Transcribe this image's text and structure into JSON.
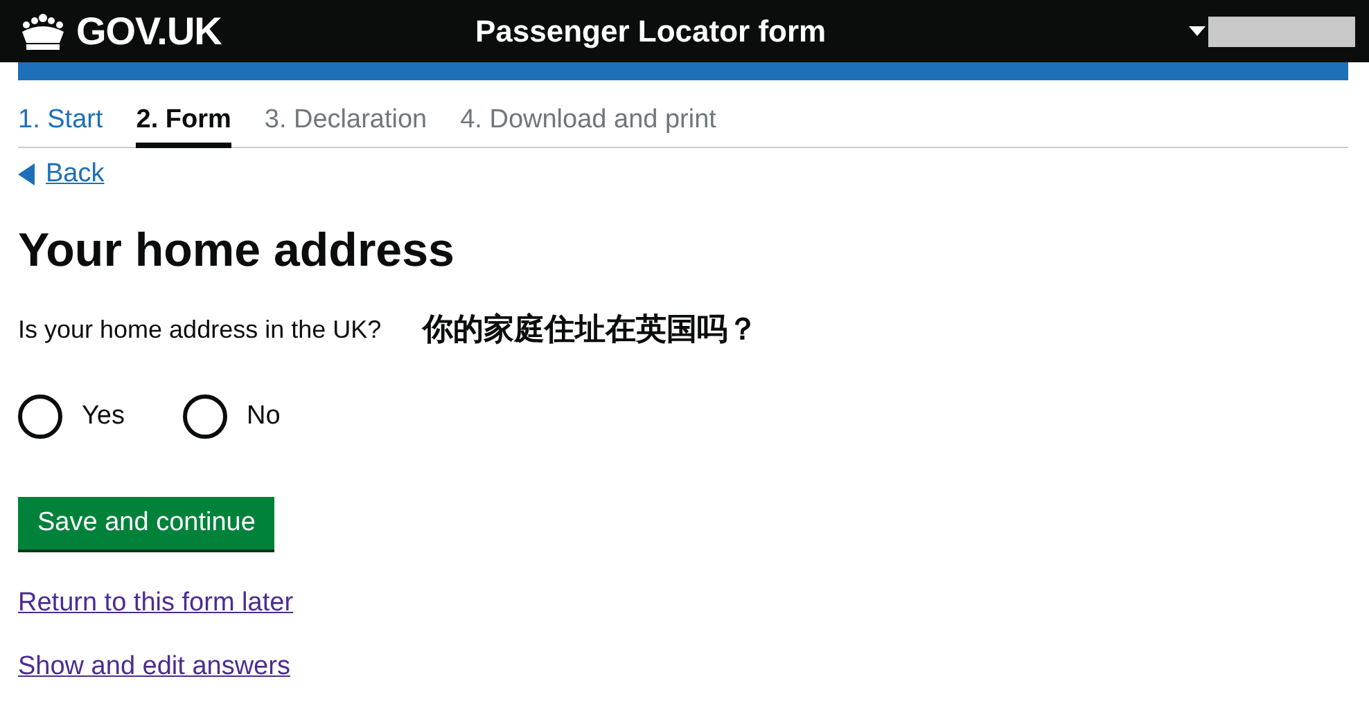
{
  "header": {
    "logo": "GOV.UK",
    "title": "Passenger Locator form"
  },
  "steps": [
    {
      "label": "1. Start",
      "kind": "done"
    },
    {
      "label": "2. Form",
      "kind": "current"
    },
    {
      "label": "3. Declaration",
      "kind": "upcoming"
    },
    {
      "label": "4. Download and print",
      "kind": "upcoming"
    }
  ],
  "back_link": "Back",
  "heading": "Your home address",
  "question": "Is your home address in the UK?",
  "annotation": "你的家庭住址在英国吗？",
  "options": [
    {
      "label": "Yes",
      "selected": false
    },
    {
      "label": "No",
      "selected": false
    }
  ],
  "button": "Save and continue",
  "links": [
    "Return to this form later",
    "Show and edit answers"
  ]
}
